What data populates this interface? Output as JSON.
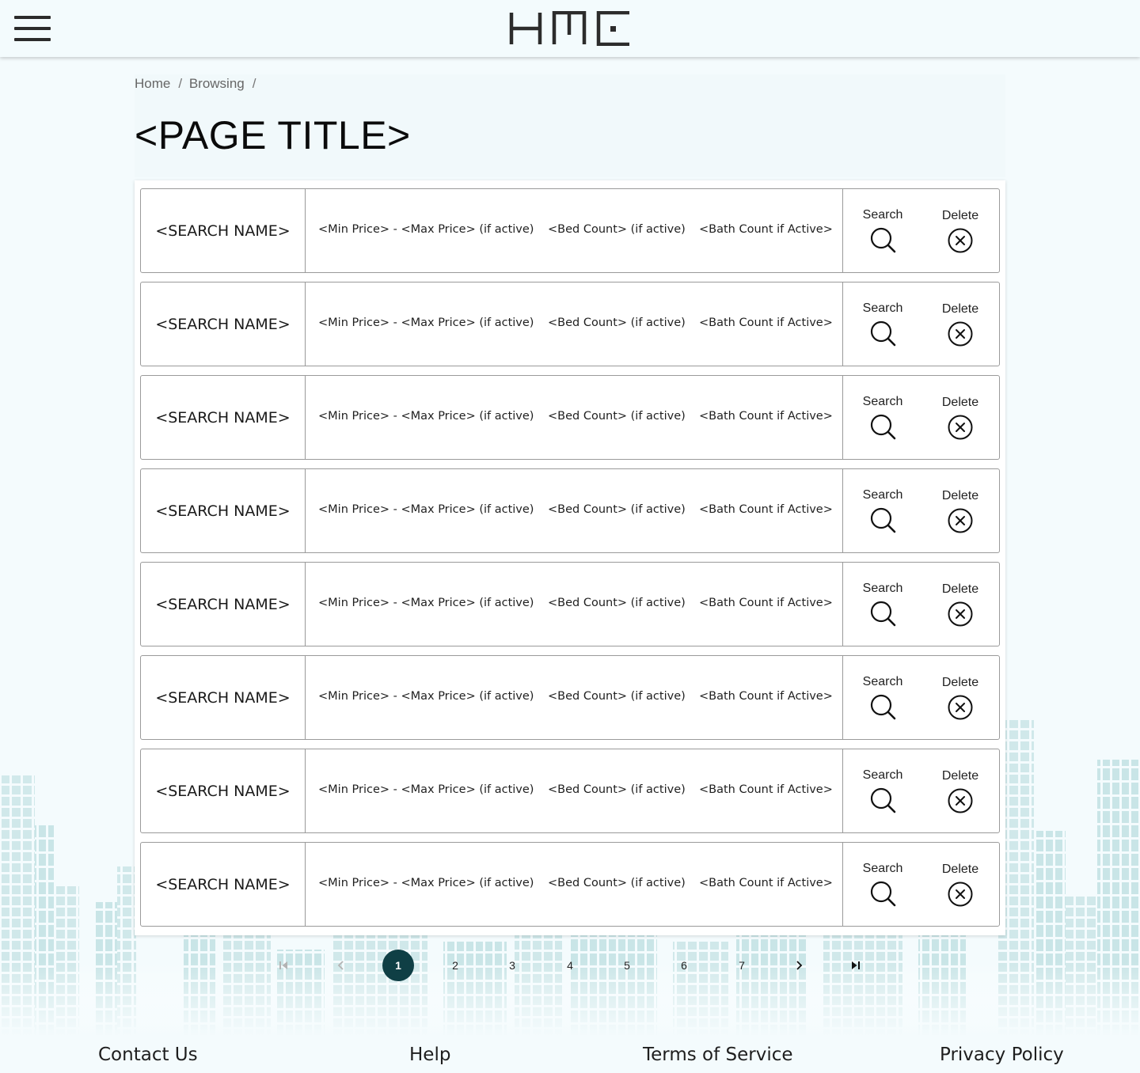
{
  "header": {
    "menu_icon": "hamburger-menu-icon",
    "logo_text": "HME",
    "accent_color": "#0f3f45"
  },
  "breadcrumb": [
    "Home",
    "Browsing"
  ],
  "page_title": "<PAGE TITLE>",
  "searches": [
    {
      "name": "<SEARCH NAME>",
      "price": "<Min Price> - <Max Price> (if active)",
      "beds": "<Bed Count> (if active)",
      "baths": "<Bath Count if Active>",
      "search_label": "Search",
      "delete_label": "Delete"
    },
    {
      "name": "<SEARCH NAME>",
      "price": "<Min Price> - <Max Price> (if active)",
      "beds": "<Bed Count> (if active)",
      "baths": "<Bath Count if Active>",
      "search_label": "Search",
      "delete_label": "Delete"
    },
    {
      "name": "<SEARCH NAME>",
      "price": "<Min Price> - <Max Price> (if active)",
      "beds": "<Bed Count> (if active)",
      "baths": "<Bath Count if Active>",
      "search_label": "Search",
      "delete_label": "Delete"
    },
    {
      "name": "<SEARCH NAME>",
      "price": "<Min Price> - <Max Price> (if active)",
      "beds": "<Bed Count> (if active)",
      "baths": "<Bath Count if Active>",
      "search_label": "Search",
      "delete_label": "Delete"
    },
    {
      "name": "<SEARCH NAME>",
      "price": "<Min Price> - <Max Price> (if active)",
      "beds": "<Bed Count> (if active)",
      "baths": "<Bath Count if Active>",
      "search_label": "Search",
      "delete_label": "Delete"
    },
    {
      "name": "<SEARCH NAME>",
      "price": "<Min Price> - <Max Price> (if active)",
      "beds": "<Bed Count> (if active)",
      "baths": "<Bath Count if Active>",
      "search_label": "Search",
      "delete_label": "Delete"
    },
    {
      "name": "<SEARCH NAME>",
      "price": "<Min Price> - <Max Price> (if active)",
      "beds": "<Bed Count> (if active)",
      "baths": "<Bath Count if Active>",
      "search_label": "Search",
      "delete_label": "Delete"
    },
    {
      "name": "<SEARCH NAME>",
      "price": "<Min Price> - <Max Price> (if active)",
      "beds": "<Bed Count> (if active)",
      "baths": "<Bath Count if Active>",
      "search_label": "Search",
      "delete_label": "Delete"
    }
  ],
  "pagination": {
    "first_icon": "first-page-icon",
    "prev_icon": "chevron-left-icon",
    "next_icon": "chevron-right-icon",
    "last_icon": "last-page-icon",
    "pages": [
      "1",
      "2",
      "3",
      "4",
      "5",
      "6",
      "7"
    ],
    "current": "1"
  },
  "footer": {
    "links": [
      "Contact Us",
      "Help",
      "Terms of Service",
      "Privacy Policy"
    ]
  }
}
